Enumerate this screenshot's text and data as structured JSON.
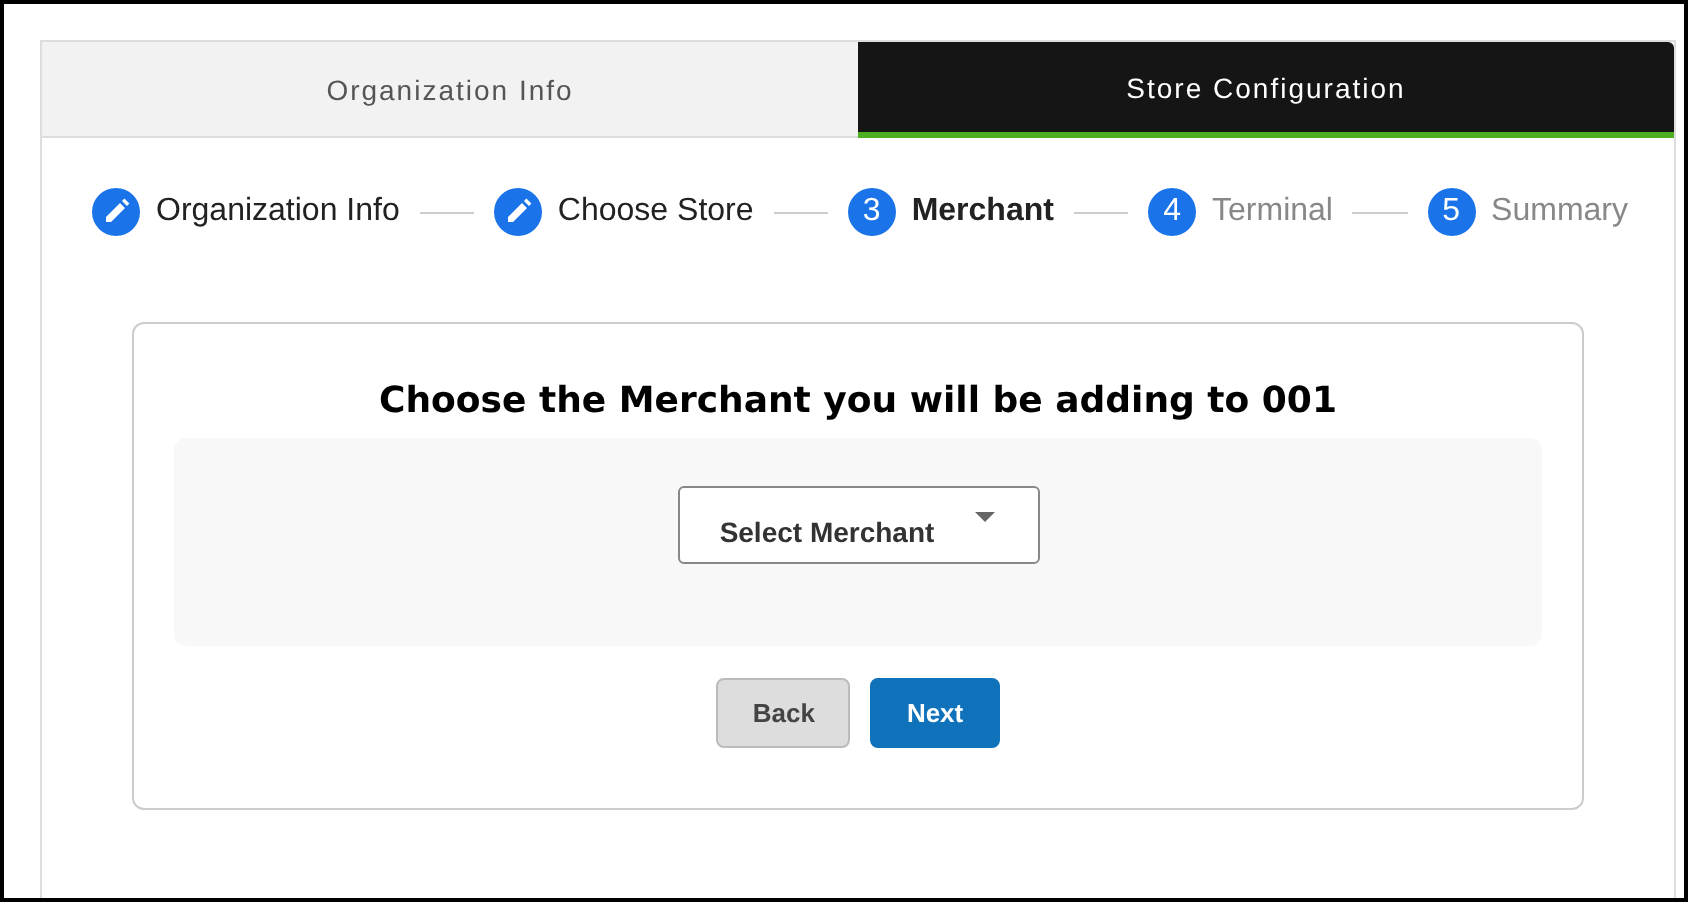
{
  "tabs": [
    {
      "label": "Organization Info",
      "selected": false
    },
    {
      "label": "Store Configuration",
      "selected": true
    }
  ],
  "steps": [
    {
      "label": "Organization Info",
      "kind": "done"
    },
    {
      "label": "Choose Store",
      "kind": "done"
    },
    {
      "label": "Merchant",
      "kind": "current",
      "number": "3"
    },
    {
      "label": "Terminal",
      "kind": "pending",
      "number": "4"
    },
    {
      "label": "Summary",
      "kind": "pending",
      "number": "5"
    }
  ],
  "card": {
    "title": "Choose the Merchant you will be adding to 001",
    "select": {
      "placeholder": "Select Merchant"
    },
    "buttons": [
      {
        "label": "Back",
        "kind": "secondary"
      },
      {
        "label": "Next",
        "kind": "primary"
      }
    ]
  }
}
